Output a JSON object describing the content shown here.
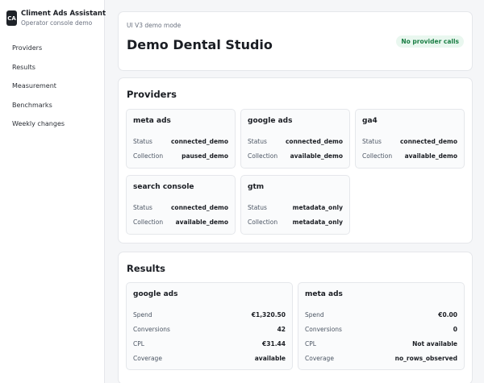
{
  "app": {
    "logo": "CA",
    "title": "Climent Ads Assistant",
    "subtitle": "Operator console demo"
  },
  "nav": [
    "Providers",
    "Results",
    "Measurement",
    "Benchmarks",
    "Weekly changes"
  ],
  "header": {
    "mode": "UI V3 demo mode",
    "title": "Demo Dental Studio",
    "badge": "No provider calls"
  },
  "providers": {
    "title": "Providers",
    "items": [
      {
        "name": "meta ads",
        "status_label": "Status",
        "status": "connected_demo",
        "collection_label": "Collection",
        "collection": "paused_demo"
      },
      {
        "name": "google ads",
        "status_label": "Status",
        "status": "connected_demo",
        "collection_label": "Collection",
        "collection": "available_demo"
      },
      {
        "name": "ga4",
        "status_label": "Status",
        "status": "connected_demo",
        "collection_label": "Collection",
        "collection": "available_demo"
      },
      {
        "name": "search console",
        "status_label": "Status",
        "status": "connected_demo",
        "collection_label": "Collection",
        "collection": "available_demo"
      },
      {
        "name": "gtm",
        "status_label": "Status",
        "status": "metadata_only",
        "collection_label": "Collection",
        "collection": "metadata_only"
      }
    ]
  },
  "results": {
    "title": "Results",
    "items": [
      {
        "name": "google ads",
        "rows": [
          {
            "label": "Spend",
            "value": "€1,320.50"
          },
          {
            "label": "Conversions",
            "value": "42"
          },
          {
            "label": "CPL",
            "value": "€31.44"
          },
          {
            "label": "Coverage",
            "value": "available"
          }
        ]
      },
      {
        "name": "meta ads",
        "rows": [
          {
            "label": "Spend",
            "value": "€0.00"
          },
          {
            "label": "Conversions",
            "value": "0"
          },
          {
            "label": "CPL",
            "value": "Not available"
          },
          {
            "label": "Coverage",
            "value": "no_rows_observed"
          }
        ]
      }
    ]
  }
}
